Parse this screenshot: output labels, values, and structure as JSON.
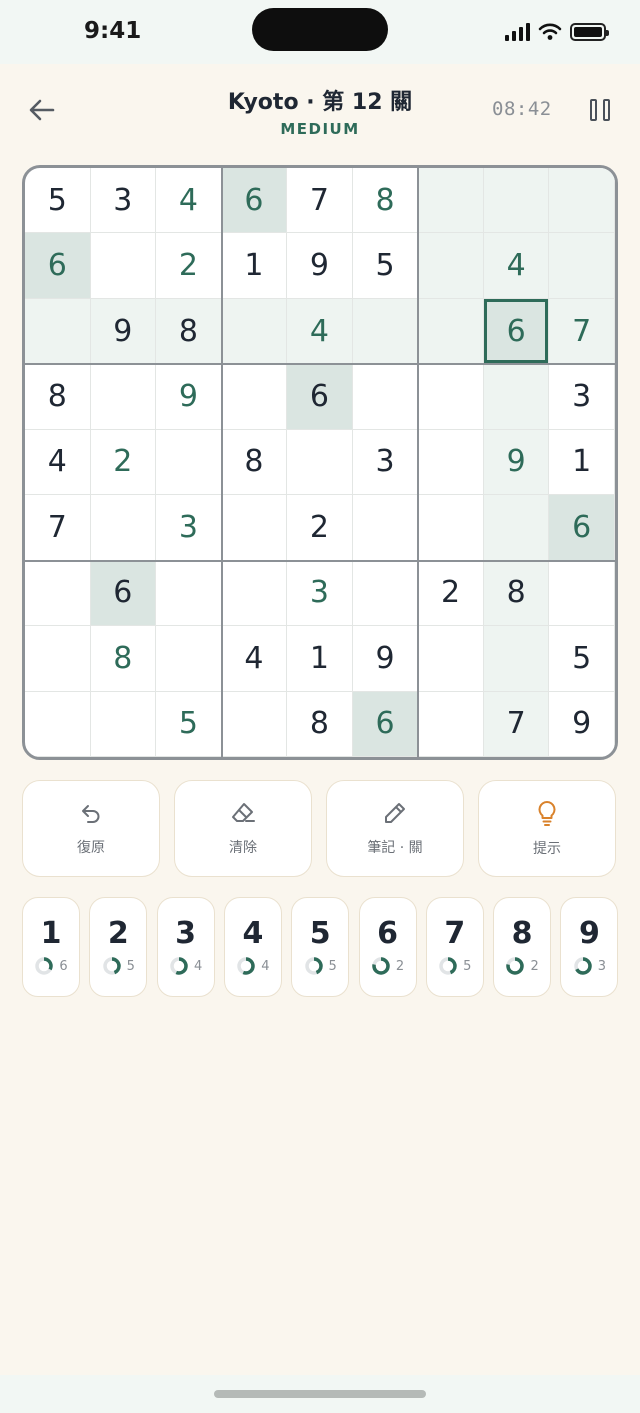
{
  "status_bar": {
    "time": "9:41"
  },
  "header": {
    "title": "Kyoto · 第 12 關",
    "difficulty": "MEDIUM",
    "timer": "08:42"
  },
  "board": {
    "givens": [
      [
        5,
        3,
        0,
        0,
        7,
        0,
        0,
        0,
        0
      ],
      [
        0,
        0,
        0,
        1,
        9,
        5,
        0,
        0,
        0
      ],
      [
        0,
        9,
        8,
        0,
        0,
        0,
        0,
        0,
        0
      ],
      [
        8,
        0,
        0,
        0,
        6,
        0,
        0,
        0,
        3
      ],
      [
        4,
        0,
        0,
        8,
        0,
        3,
        0,
        0,
        1
      ],
      [
        7,
        0,
        0,
        0,
        2,
        0,
        0,
        0,
        0
      ],
      [
        0,
        6,
        0,
        0,
        0,
        0,
        2,
        8,
        0
      ],
      [
        0,
        0,
        0,
        4,
        1,
        9,
        0,
        0,
        5
      ],
      [
        0,
        0,
        0,
        0,
        8,
        0,
        0,
        7,
        9
      ]
    ],
    "entries": [
      [
        0,
        0,
        4,
        6,
        0,
        8,
        0,
        0,
        0
      ],
      [
        6,
        0,
        2,
        0,
        0,
        0,
        0,
        4,
        0
      ],
      [
        0,
        0,
        0,
        0,
        4,
        0,
        0,
        6,
        7
      ],
      [
        0,
        0,
        9,
        0,
        0,
        0,
        0,
        0,
        0
      ],
      [
        0,
        2,
        0,
        0,
        0,
        0,
        0,
        9,
        0
      ],
      [
        0,
        0,
        3,
        0,
        0,
        0,
        0,
        0,
        6
      ],
      [
        0,
        0,
        0,
        0,
        3,
        0,
        0,
        0,
        0
      ],
      [
        0,
        8,
        0,
        0,
        0,
        0,
        0,
        0,
        0
      ],
      [
        0,
        0,
        5,
        0,
        0,
        6,
        0,
        0,
        0
      ]
    ],
    "selected": {
      "row": 2,
      "col": 7
    }
  },
  "tools": [
    {
      "label": "復原",
      "icon": "undo-icon"
    },
    {
      "label": "清除",
      "icon": "eraser-icon"
    },
    {
      "label": "筆記 · 關",
      "icon": "pencil-icon"
    },
    {
      "label": "提示",
      "icon": "lightbulb-icon"
    }
  ],
  "numpad": [
    {
      "digit": "1",
      "remaining": "6",
      "placed_fraction": 0.33
    },
    {
      "digit": "2",
      "remaining": "5",
      "placed_fraction": 0.44
    },
    {
      "digit": "3",
      "remaining": "4",
      "placed_fraction": 0.56
    },
    {
      "digit": "4",
      "remaining": "4",
      "placed_fraction": 0.56
    },
    {
      "digit": "5",
      "remaining": "5",
      "placed_fraction": 0.44
    },
    {
      "digit": "6",
      "remaining": "2",
      "placed_fraction": 0.78
    },
    {
      "digit": "7",
      "remaining": "5",
      "placed_fraction": 0.44
    },
    {
      "digit": "8",
      "remaining": "2",
      "placed_fraction": 0.78
    },
    {
      "digit": "9",
      "remaining": "3",
      "placed_fraction": 0.67
    }
  ],
  "colors": {
    "background": "#FAF6EE",
    "accent": "#2E6B59",
    "hint": "#D9822B",
    "given_digit": "#1F2733"
  }
}
